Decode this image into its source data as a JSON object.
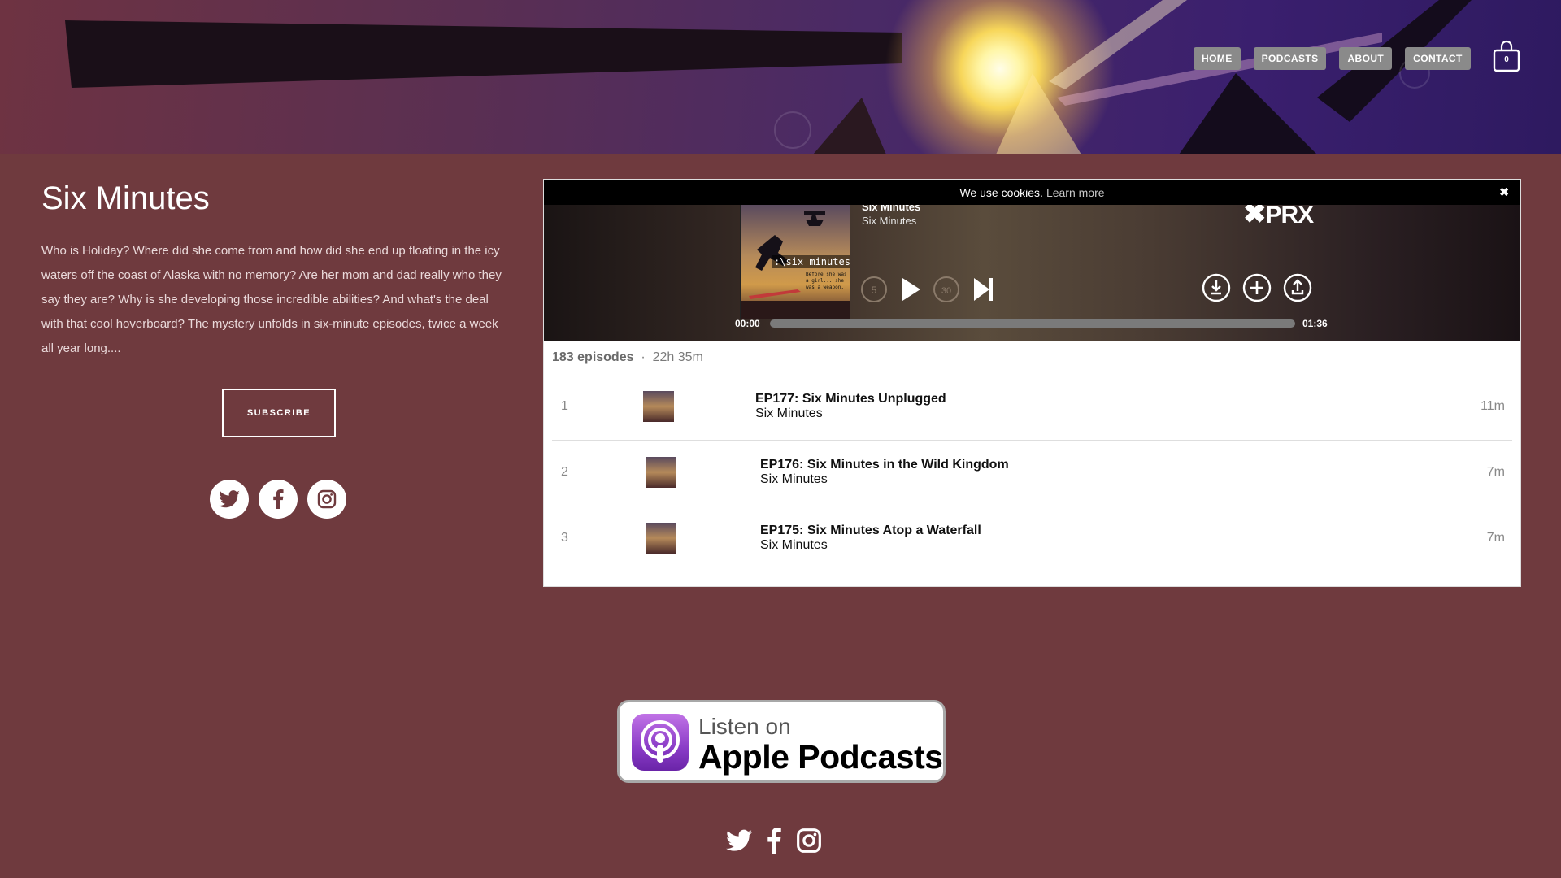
{
  "header": {
    "nav": [
      {
        "label": "HOME"
      },
      {
        "label": "PODCASTS"
      },
      {
        "label": "ABOUT"
      },
      {
        "label": "CONTACT"
      }
    ],
    "cart_count": "0"
  },
  "intro": {
    "title": "Six Minutes",
    "description": "Who is Holiday? Where did she come from and how did she end up floating in the icy waters off the coast of Alaska with no memory?  Are her mom and dad really who they say they are? Why is she developing those incredible abilities? And what's the deal with that cool hoverboard? The mystery unfolds in six-minute episodes, twice a week all year long....",
    "subscribe_label": "SUBSCRIBE",
    "social": [
      "twitter-icon",
      "facebook-icon",
      "instagram-icon"
    ]
  },
  "player": {
    "cookie_text": "We use cookies.",
    "cookie_link": "Learn more",
    "cookie_close": "✖",
    "now_playing_title": "Six Minutes",
    "now_playing_show": "Six Minutes",
    "brand": "PRX",
    "cover_text": ":\\six_minutes",
    "cover_small_text": "Before she was a girl... she was a weapon.",
    "skip_back_label": "5",
    "skip_forward_label": "30",
    "time_current": "00:00",
    "time_total": "01:36",
    "progress": 0,
    "episode_count": "183 episodes",
    "separator": "·",
    "total_duration": "22h 35m",
    "episodes": [
      {
        "number": "1",
        "title": "EP177: Six Minutes Unplugged",
        "show": "Six Minutes",
        "duration": "11m"
      },
      {
        "number": "2",
        "title": "EP176: Six Minutes in the Wild Kingdom",
        "show": "Six Minutes",
        "duration": "7m"
      },
      {
        "number": "3",
        "title": "EP175: Six Minutes Atop a Waterfall",
        "show": "Six Minutes",
        "duration": "7m"
      }
    ]
  },
  "apple_badge": {
    "line1": "Listen on",
    "line2": "Apple Podcasts"
  },
  "footer": {
    "social": [
      "twitter-icon",
      "facebook-icon",
      "instagram-icon"
    ]
  },
  "colors": {
    "page_bg": "#6f3a3e",
    "nav_button": "#8a8a8a",
    "accent_purple": "#8a3cc7"
  }
}
